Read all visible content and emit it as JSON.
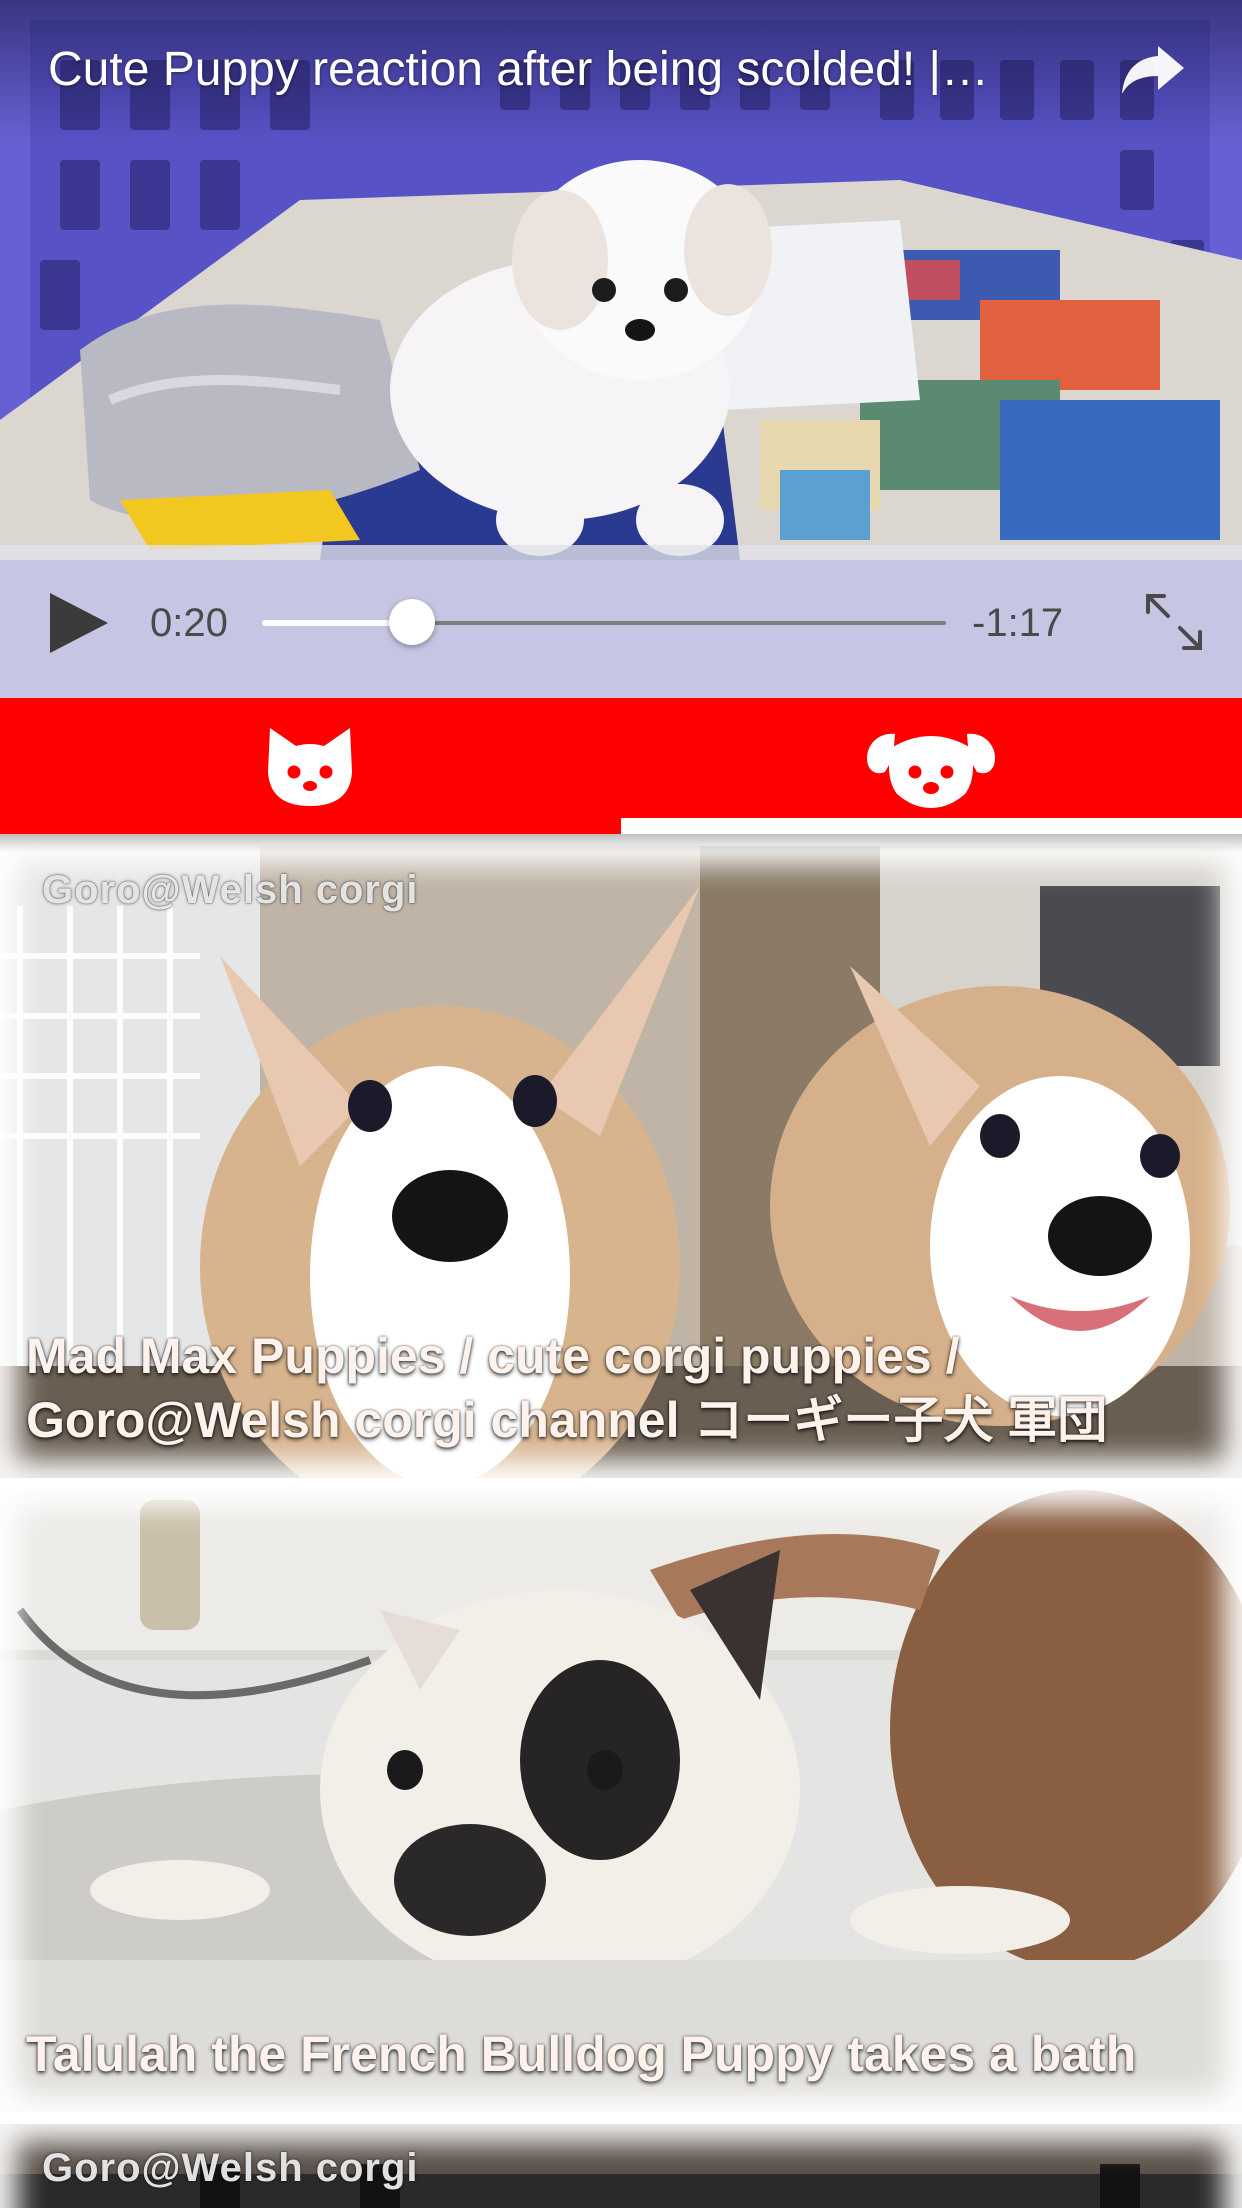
{
  "player": {
    "title": "Cute Puppy reaction after being scolded! |…",
    "current_time": "0:20",
    "remaining_time": "-1:17",
    "progress": 0.22,
    "share_icon": "share-arrow-icon",
    "play_icon": "play-icon",
    "fullscreen_icon": "expand-icon"
  },
  "tabs": [
    {
      "name": "cats",
      "icon": "cat-face-icon",
      "selected": false
    },
    {
      "name": "dogs",
      "icon": "dog-face-icon",
      "selected": true
    }
  ],
  "colors": {
    "accent": "#ff0000",
    "tab_indicator": "#ffffff"
  },
  "feed": {
    "items": [
      {
        "watermark": "Goro@Welsh corgi",
        "title": "Mad Max Puppies / cute corgi puppies / Goro@Welsh corgi channel コーギー子犬 軍団"
      },
      {
        "watermark": "",
        "title": "Talulah the French Bulldog Puppy takes a bath"
      },
      {
        "watermark": "Goro@Welsh corgi",
        "title": ""
      }
    ]
  }
}
